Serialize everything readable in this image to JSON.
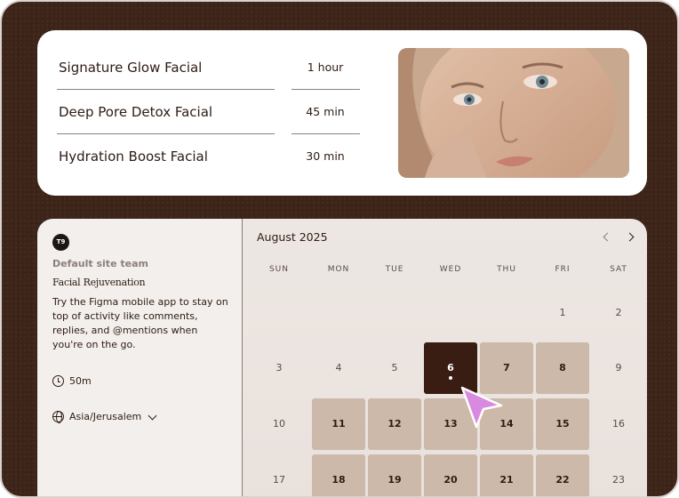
{
  "services": [
    {
      "name": "Signature Glow Facial",
      "duration": "1 hour"
    },
    {
      "name": "Deep Pore Detox Facial",
      "duration": "45 min"
    },
    {
      "name": "Hydration Boost Facial",
      "duration": "30 min"
    }
  ],
  "event": {
    "team_initials": "T9",
    "team_name": "Default site team",
    "name": "Facial Rejuvenation",
    "description": "Try the Figma mobile app to stay on top of activity like comments, replies, and @mentions when you're on the go.",
    "duration": "50m",
    "timezone": "Asia/Jerusalem"
  },
  "calendar": {
    "month": "August 2025",
    "weekdays": [
      "SUN",
      "MON",
      "TUE",
      "WED",
      "THU",
      "FRI",
      "SAT"
    ],
    "weeks": [
      [
        {
          "d": ""
        },
        {
          "d": ""
        },
        {
          "d": ""
        },
        {
          "d": ""
        },
        {
          "d": ""
        },
        {
          "d": "1",
          "s": "plain"
        },
        {
          "d": "2",
          "s": "plain"
        }
      ],
      [
        {
          "d": "3",
          "s": "plain"
        },
        {
          "d": "4",
          "s": "plain"
        },
        {
          "d": "5",
          "s": "plain"
        },
        {
          "d": "6",
          "s": "selected"
        },
        {
          "d": "7",
          "s": "available"
        },
        {
          "d": "8",
          "s": "available"
        },
        {
          "d": "9",
          "s": "plain"
        }
      ],
      [
        {
          "d": "10",
          "s": "plain"
        },
        {
          "d": "11",
          "s": "available"
        },
        {
          "d": "12",
          "s": "available"
        },
        {
          "d": "13",
          "s": "available"
        },
        {
          "d": "14",
          "s": "available"
        },
        {
          "d": "15",
          "s": "available"
        },
        {
          "d": "16",
          "s": "plain"
        }
      ],
      [
        {
          "d": "17",
          "s": "plain"
        },
        {
          "d": "18",
          "s": "available"
        },
        {
          "d": "19",
          "s": "available"
        },
        {
          "d": "20",
          "s": "available"
        },
        {
          "d": "21",
          "s": "available"
        },
        {
          "d": "22",
          "s": "available"
        },
        {
          "d": "23",
          "s": "plain"
        }
      ]
    ]
  },
  "colors": {
    "background": "#3d2418",
    "selected_day": "#3a1d12",
    "available_day": "#ccb9aa",
    "cursor": "#d98ae0"
  },
  "icons": {
    "duration": "clock-icon",
    "timezone": "globe-icon",
    "cursor": "cursor-arrow-icon"
  }
}
